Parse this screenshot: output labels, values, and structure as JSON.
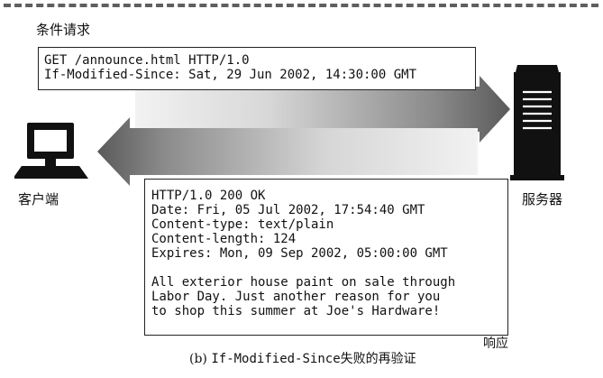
{
  "request": {
    "heading": "条件请求",
    "lines": [
      "GET /announce.html HTTP/1.0",
      "If-Modified-Since: Sat, 29 Jun 2002, 14:30:00 GMT"
    ]
  },
  "client": {
    "label": "客户端",
    "icon": "computer-icon"
  },
  "server": {
    "label": "服务器",
    "icon": "server-rack-icon"
  },
  "response": {
    "label": "响应",
    "header_lines": [
      "HTTP/1.0 200 OK",
      "Date: Fri, 05 Jul 2002, 17:54:40 GMT",
      "Content-type: text/plain",
      "Content-length: 124",
      "Expires: Mon, 09 Sep 2002, 05:00:00 GMT"
    ],
    "body_lines": [
      "All exterior house paint on sale through",
      "Labor Day. Just another reason for you",
      "to shop this summer at Joe's Hardware!"
    ]
  },
  "caption": {
    "tag": "(b)",
    "code": "If-Modified-Since",
    "text": "失败的再验证"
  },
  "colors": {
    "arrow_dark": "#5a5a5a",
    "arrow_light": "#e4e4e4",
    "ink": "#111111"
  }
}
